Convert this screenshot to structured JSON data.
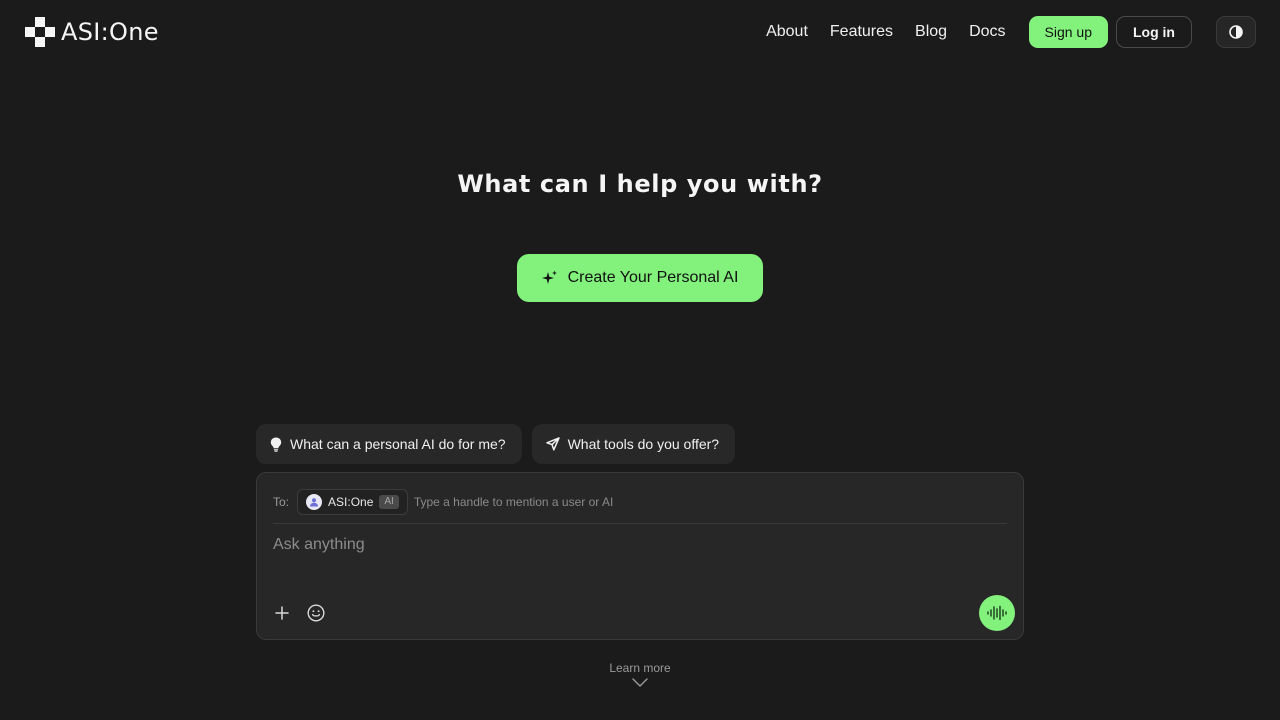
{
  "brand": {
    "name": "ASI:One"
  },
  "nav": {
    "links": [
      "About",
      "Features",
      "Blog",
      "Docs"
    ],
    "signup_label": "Sign up",
    "login_label": "Log in"
  },
  "hero": {
    "title": "What can I help you with?",
    "create_label": "Create Your Personal AI"
  },
  "suggestions": [
    {
      "label": "What can a personal AI do for me?",
      "icon": "lightbulb-icon"
    },
    {
      "label": "What tools do you offer?",
      "icon": "send-icon"
    }
  ],
  "composer": {
    "to_label": "To:",
    "recipient": {
      "name": "ASI:One",
      "badge": "AI"
    },
    "handle_placeholder": "Type a handle to mention a user or AI",
    "ask_placeholder": "Ask anything"
  },
  "footer": {
    "learn_more": "Learn more"
  },
  "colors": {
    "background": "#1b1b1b",
    "accent": "#83f27d",
    "surface": "#272727"
  }
}
